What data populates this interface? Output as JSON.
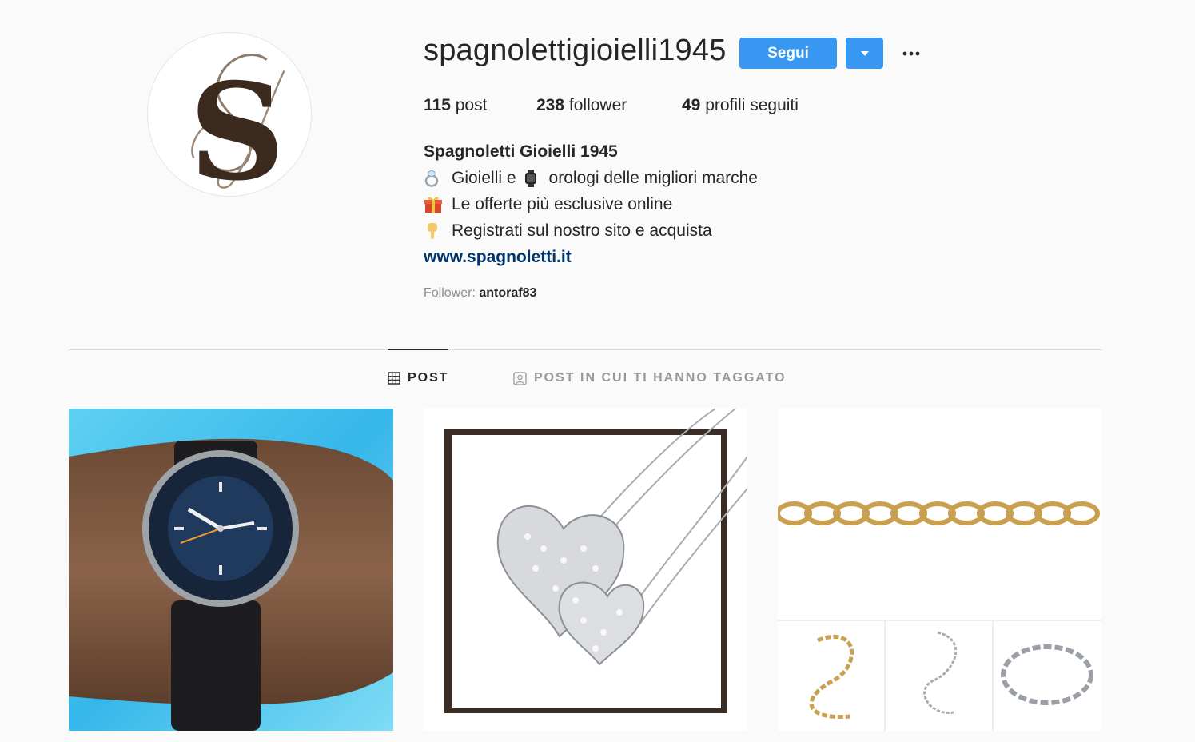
{
  "profile": {
    "username": "spagnolettigioielli1945",
    "avatar_icon": "s-monogram-logo",
    "follow_label": "Segui",
    "dropdown_icon": "caret-down-icon",
    "more_icon": "ellipsis-icon",
    "stats": {
      "posts_count": "115",
      "posts_label": "post",
      "followers_count": "238",
      "followers_label": "follower",
      "following_count": "49",
      "following_label": "profili seguiti"
    },
    "full_name": "Spagnoletti Gioielli 1945",
    "bio": {
      "line1_part1": "Gioielli e",
      "line1_part2": "orologi delle migliori marche",
      "line2": "Le offerte più esclusive online",
      "line3": "Registrati sul nostro sito e acquista"
    },
    "website": "www.spagnoletti.it",
    "followed_by_label": "Follower:",
    "followed_by_name": "antoraf83"
  },
  "tabs": [
    {
      "label": "POST",
      "icon": "grid-icon",
      "active": true
    },
    {
      "label": "POST IN CUI TI HANNO TAGGATO",
      "icon": "tag-person-icon",
      "active": false
    }
  ],
  "posts": [
    {
      "subject": "watch-on-wrist"
    },
    {
      "subject": "heart-pendants"
    },
    {
      "subject": "chain-bracelets"
    }
  ],
  "colors": {
    "accent": "#3897f0",
    "link": "#003569",
    "text": "#262626",
    "muted": "#8e8e8e",
    "background": "#fafafa"
  }
}
